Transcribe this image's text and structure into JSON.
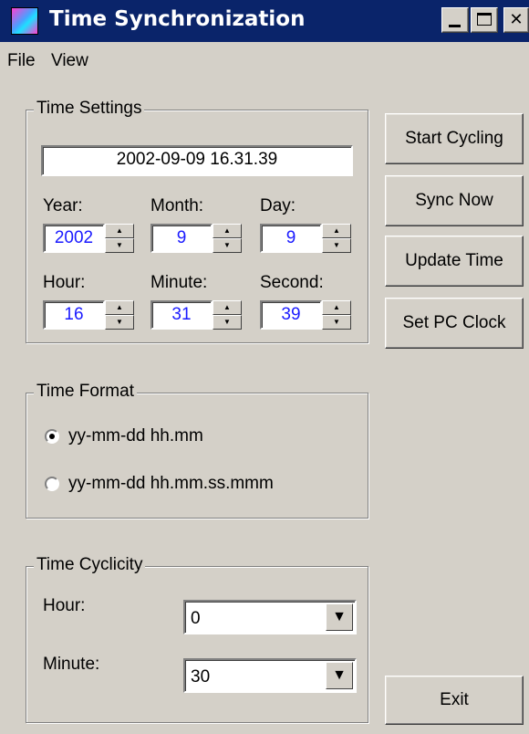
{
  "window": {
    "title": "Time Synchronization"
  },
  "menu": {
    "file": "File",
    "view": "View"
  },
  "time_settings": {
    "title": "Time Settings",
    "datetime": "2002-09-09 16.31.39",
    "year": {
      "label": "Year:",
      "value": "2002"
    },
    "month": {
      "label": "Month:",
      "value": "9"
    },
    "day": {
      "label": "Day:",
      "value": "9"
    },
    "hour": {
      "label": "Hour:",
      "value": "16"
    },
    "minute": {
      "label": "Minute:",
      "value": "31"
    },
    "second": {
      "label": "Second:",
      "value": "39"
    }
  },
  "time_format": {
    "title": "Time Format",
    "option1": "yy-mm-dd hh.mm",
    "option2": "yy-mm-dd hh.mm.ss.mmm",
    "selected": "option1"
  },
  "time_cyclicity": {
    "title": "Time Cyclicity",
    "hour": {
      "label": "Hour:",
      "value": "0"
    },
    "minute": {
      "label": "Minute:",
      "value": "30"
    }
  },
  "buttons": {
    "start_cycling": "Start Cycling",
    "sync_now": "Sync Now",
    "update_time": "Update Time",
    "set_pc_clock": "Set PC Clock",
    "exit": "Exit"
  },
  "icons": {
    "app": "app-icon",
    "minimize": "minimize-icon",
    "maximize": "maximize-icon",
    "close": "close-icon",
    "spin_up": "spin-up-icon",
    "spin_down": "spin-down-icon",
    "dropdown": "dropdown-arrow-icon"
  },
  "colors": {
    "titlebar": "#0a246a",
    "window_bg": "#d4d0c8",
    "spin_text": "#1a1aff"
  }
}
